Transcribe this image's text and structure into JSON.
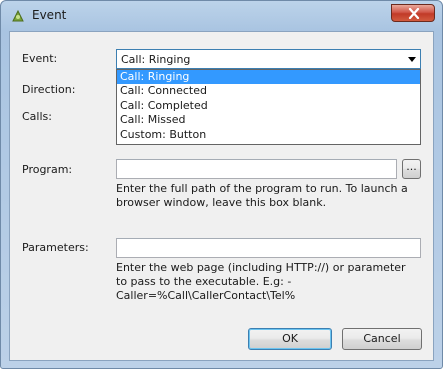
{
  "window": {
    "title": "Event"
  },
  "labels": {
    "event": "Event:",
    "direction": "Direction:",
    "calls": "Calls:",
    "program": "Program:",
    "parameters": "Parameters:"
  },
  "event_select": {
    "value": "Call: Ringing",
    "options": [
      "Call: Ringing",
      "Call: Connected",
      "Call: Completed",
      "Call: Missed",
      "Custom: Button"
    ]
  },
  "program": {
    "value": "",
    "browse_label": "...",
    "help": "Enter the full path of the program to run. To launch a browser window, leave this box blank."
  },
  "parameters": {
    "value": "",
    "help": "Enter the web page (including HTTP://) or parameter to pass to the executable. E.g: -Caller=%Call\\CallerContact\\Tel%"
  },
  "buttons": {
    "ok": "OK",
    "cancel": "Cancel"
  }
}
